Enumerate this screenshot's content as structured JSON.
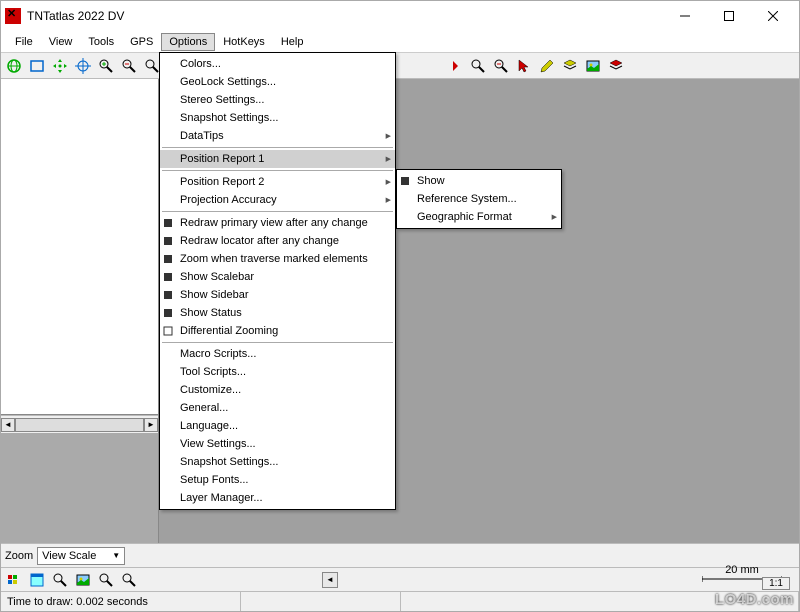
{
  "title": "TNTatlas 2022 DV",
  "menubar": [
    "File",
    "View",
    "Tools",
    "GPS",
    "Options",
    "HotKeys",
    "Help"
  ],
  "active_menu_index": 4,
  "options_menu": {
    "items": [
      {
        "label": "Colors...",
        "type": "item"
      },
      {
        "label": "GeoLock Settings...",
        "type": "item"
      },
      {
        "label": "Stereo Settings...",
        "type": "item"
      },
      {
        "label": "Snapshot Settings...",
        "type": "item"
      },
      {
        "label": "DataTips",
        "type": "sub"
      },
      {
        "type": "sep"
      },
      {
        "label": "Position Report 1",
        "type": "sub",
        "highlight": true
      },
      {
        "type": "sep"
      },
      {
        "label": "Position Report 2",
        "type": "sub"
      },
      {
        "label": "Projection Accuracy",
        "type": "sub"
      },
      {
        "type": "sep"
      },
      {
        "label": "Redraw primary view after any change",
        "type": "check",
        "checked": true
      },
      {
        "label": "Redraw locator after any change",
        "type": "check",
        "checked": true
      },
      {
        "label": "Zoom when traverse marked elements",
        "type": "check",
        "checked": true
      },
      {
        "label": "Show Scalebar",
        "type": "check",
        "checked": true
      },
      {
        "label": "Show Sidebar",
        "type": "check",
        "checked": true
      },
      {
        "label": "Show Status",
        "type": "check",
        "checked": true
      },
      {
        "label": "Differential Zooming",
        "type": "check",
        "checked": false
      },
      {
        "type": "sep"
      },
      {
        "label": "Macro Scripts...",
        "type": "item"
      },
      {
        "label": "Tool Scripts...",
        "type": "item"
      },
      {
        "label": "Customize...",
        "type": "item"
      },
      {
        "label": "General...",
        "type": "item"
      },
      {
        "label": "Language...",
        "type": "item"
      },
      {
        "label": "View Settings...",
        "type": "item"
      },
      {
        "label": "Snapshot Settings...",
        "type": "item"
      },
      {
        "label": "Setup Fonts...",
        "type": "item"
      },
      {
        "label": "Layer Manager...",
        "type": "item"
      }
    ]
  },
  "submenu": {
    "items": [
      {
        "label": "Show",
        "type": "check",
        "checked": true
      },
      {
        "label": "Reference System...",
        "type": "item"
      },
      {
        "label": "Geographic Format",
        "type": "sub"
      }
    ]
  },
  "zoom": {
    "label": "Zoom",
    "selected": "View Scale"
  },
  "status": {
    "time": "Time to draw: 0.002 seconds"
  },
  "scale": {
    "label": "20 mm",
    "ratio": "1:1"
  },
  "watermark": "LO4D.com",
  "toolbar_icons_row1": [
    "globe",
    "rect-select",
    "move",
    "crosshair",
    "zoom-in",
    "zoom-out",
    "zoom-fit",
    "zoom-full",
    "zoom-prev",
    "pan-left",
    "pan-right",
    "zoom-tool",
    "zoom-minus",
    "cursor",
    "pencil",
    "layers-yellow",
    "image-toggle",
    "layers-red"
  ],
  "toolbar_icons_row2": [
    "palette",
    "window",
    "magnify",
    "picture",
    "magnify-blue",
    "magnify-gradient"
  ]
}
